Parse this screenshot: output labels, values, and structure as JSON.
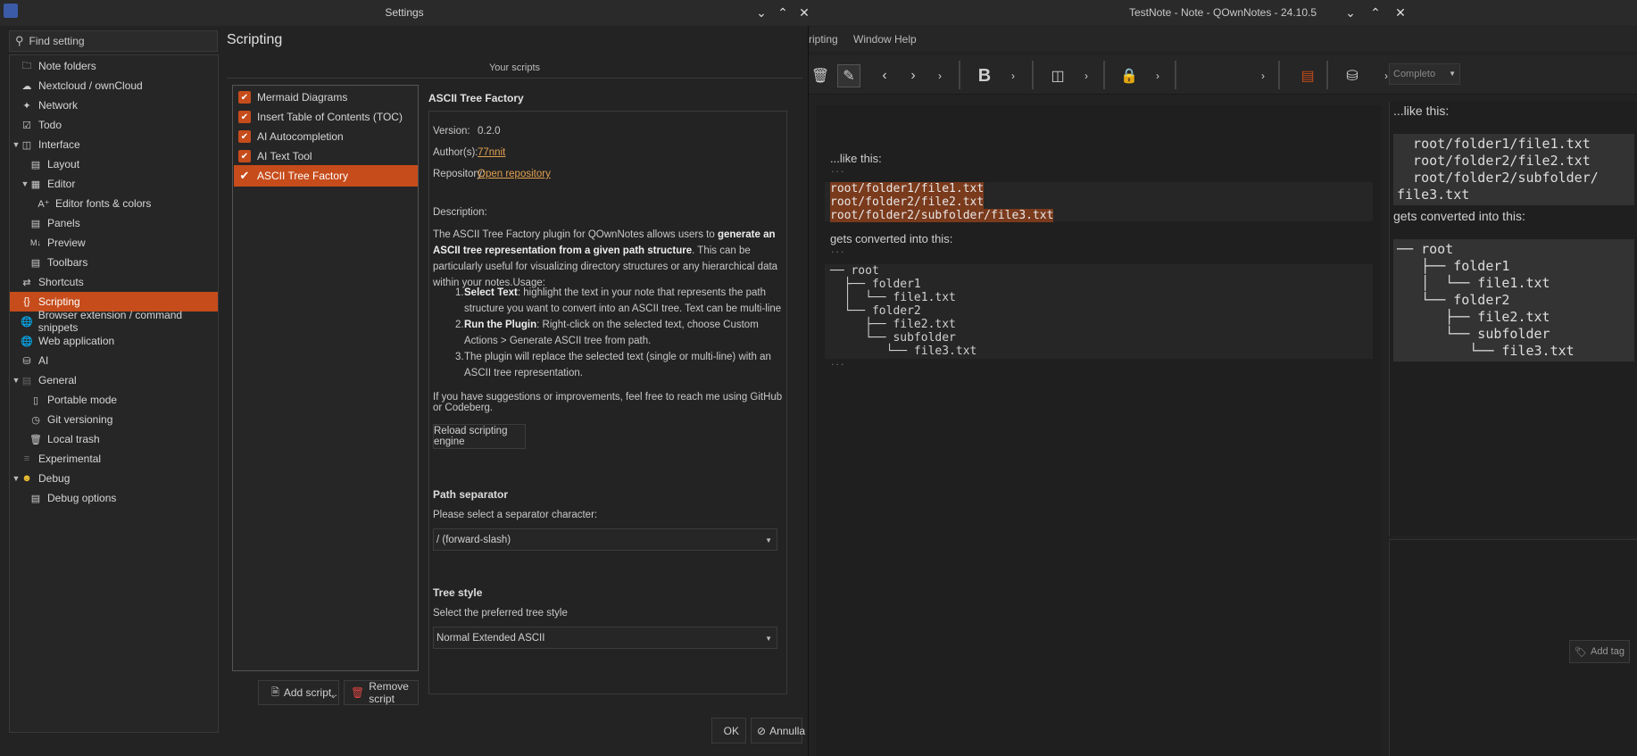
{
  "main_window": {
    "title": "TestNote - Note - QOwnNotes - 24.10.5",
    "menu": [
      "ripting",
      "Window",
      "Help"
    ],
    "preview_mode": "Completo",
    "editor": {
      "line1": "...like this:",
      "dots": "...",
      "code1": [
        "root/folder1/file1.txt",
        "root/folder2/file2.txt",
        "root/folder2/subfolder/file3.txt"
      ],
      "line2": "gets converted into this:",
      "tree": [
        "── root",
        "  ├── folder1",
        "  │  └── file1.txt",
        "  └── folder2",
        "     ├── file2.txt",
        "     └── subfolder",
        "        └── file3.txt"
      ]
    },
    "preview": {
      "line1": "...like this:",
      "code1": [
        "  root/folder1/file1.txt",
        "  root/folder2/file2.txt",
        "  root/folder2/subfolder/",
        "file3.txt"
      ],
      "line2": "gets converted into this:",
      "tree": [
        "── root",
        "   ├── folder1",
        "   │  └── file1.txt",
        "   └── folder2",
        "      ├── file2.txt",
        "      └── subfolder",
        "         └── file3.txt"
      ]
    },
    "add_tag_label": "Add tag"
  },
  "dialog": {
    "title": "Settings",
    "search_placeholder": "Find setting",
    "nav": [
      {
        "label": "Note folders",
        "icon": "folder-icon"
      },
      {
        "label": "Nextcloud / ownCloud",
        "icon": "cloud-icon"
      },
      {
        "label": "Network",
        "icon": "network-icon"
      },
      {
        "label": "Todo",
        "icon": "todo-icon"
      },
      {
        "label": "Interface",
        "icon": "interface-icon"
      },
      {
        "label": "Layout",
        "icon": "layout-icon"
      },
      {
        "label": "Editor",
        "icon": "editor-icon"
      },
      {
        "label": "Editor fonts & colors",
        "icon": "font-icon"
      },
      {
        "label": "Panels",
        "icon": "panels-icon"
      },
      {
        "label": "Preview",
        "icon": "markdown-icon"
      },
      {
        "label": "Toolbars",
        "icon": "toolbar-icon"
      },
      {
        "label": "Shortcuts",
        "icon": "shortcuts-icon"
      },
      {
        "label": "Scripting",
        "icon": "scripting-icon"
      },
      {
        "label": "Browser extension / command snippets",
        "icon": "globe-icon"
      },
      {
        "label": "Web application",
        "icon": "globe-icon"
      },
      {
        "label": "AI",
        "icon": "database-icon"
      },
      {
        "label": "General",
        "icon": "general-icon"
      },
      {
        "label": "Portable mode",
        "icon": "usb-icon"
      },
      {
        "label": "Git versioning",
        "icon": "clock-icon"
      },
      {
        "label": "Local trash",
        "icon": "trash-icon"
      },
      {
        "label": "Experimental",
        "icon": "experimental-icon"
      },
      {
        "label": "Debug",
        "icon": "smiley-icon"
      },
      {
        "label": "Debug options",
        "icon": "debug-icon"
      }
    ],
    "page_title": "Scripting",
    "scripts_group_label": "Your scripts",
    "scripts": [
      "Mermaid Diagrams",
      "Insert Table of Contents (TOC)",
      "AI Autocompletion",
      "AI Text Tool",
      "ASCII Tree Factory"
    ],
    "add_script_label": "Add script..",
    "remove_script_label": "Remove script",
    "detail": {
      "title": "ASCII Tree Factory",
      "version_label": "Version:",
      "version": "0.2.0",
      "authors_label": "Author(s):",
      "authors": "77nnit",
      "repository_label": "Repository:",
      "repository": "Open repository",
      "description_label": "Description:",
      "desc_part1": "The ASCII Tree Factory plugin for QOwnNotes allows users to ",
      "desc_bold": "generate an ASCII tree representation from a given path structure",
      "desc_part2": ". This can be particularly useful for visualizing directory structures or any hierarchical data within your notes.Usage:",
      "steps": [
        {
          "num": "1.",
          "bold": "Select Text",
          "text": ": highlight the text in your note that represents the path structure you want to convert into an ASCII tree. Text can be multi-line"
        },
        {
          "num": "2.",
          "bold": "Run the Plugin",
          "text": ": Right-click on the selected text, choose Custom Actions > Generate ASCII tree from path."
        },
        {
          "num": "3.",
          "bold": "",
          "text": "The plugin will replace the selected text (single or multi-line) with an ASCII tree representation."
        }
      ],
      "feedback": "If you have suggestions or improvements, feel free to reach me using GitHub or Codeberg.",
      "reload_label": "Reload scripting engine",
      "path_sep_title": "Path separator",
      "path_sep_sub": "Please select a separator character:",
      "path_sep_value": "/ (forward-slash)",
      "tree_style_title": "Tree style",
      "tree_style_sub": "Select the preferred tree style",
      "tree_style_value": "Normal Extended ASCII"
    },
    "ok_label": "OK",
    "cancel_label": "Annulla"
  }
}
